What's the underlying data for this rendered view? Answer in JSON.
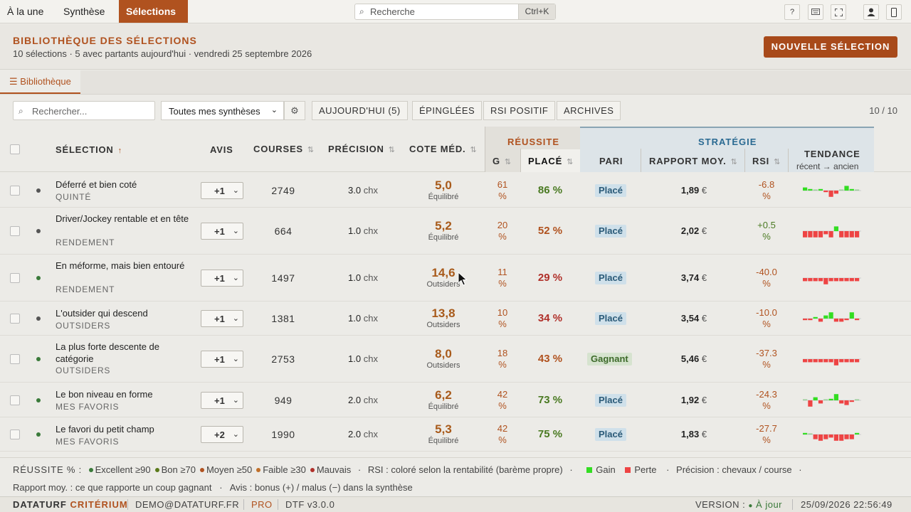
{
  "nav": {
    "tabs": [
      "À la une",
      "Synthèse",
      "Sélections"
    ],
    "active": 2
  },
  "search": {
    "placeholder": "Recherche",
    "shortcut": "Ctrl+K"
  },
  "toolbar": {
    "icons": [
      "help-icon",
      "keyboard-icon",
      "fullscreen-icon",
      "user-icon",
      "phone-icon"
    ],
    "help_label": "?"
  },
  "page": {
    "title": "BIBLIOTHÈQUE DES SÉLECTIONS",
    "subtitle": "10 sélections · 5 avec partants aujourd'hui · vendredi 25 septembre 2026",
    "new_button": "NOUVELLE SÉLECTION"
  },
  "tabs": {
    "library": "Bibliothèque"
  },
  "filters": {
    "search_placeholder": "Rechercher...",
    "select_value": "Toutes mes synthèses",
    "buttons": [
      "AUJOURD'HUI (5)",
      "ÉPINGLÉES",
      "RSI POSITIF",
      "ARCHIVES"
    ],
    "count": "10 / 10"
  },
  "columns": {
    "selection": "SÉLECTION",
    "avis": "AVIS",
    "courses": "COURSES",
    "precision": "PRÉCISION",
    "cote": "COTE MÉD.",
    "reussite": "RÉUSSITE",
    "g": "G",
    "place": "PLACÉ",
    "strategie": "STRATÉGIE",
    "pari": "PARI",
    "rapport": "RAPPORT MOY.",
    "rsi": "RSI",
    "tendance": "TENDANCE",
    "tendance_sub": "récent → ancien"
  },
  "rows": [
    {
      "name": "Déferré et bien coté",
      "category": "QUINTÉ",
      "dot": "#555555",
      "avis": "+1",
      "courses": "2749",
      "precision": "3.0",
      "unit": "chx",
      "cote": "5,0",
      "cote_label": "Équilibré",
      "g": "61",
      "pct": "%",
      "place": "86 %",
      "place_color": "#4a7a22",
      "pari": "Placé",
      "pari_type": "placed",
      "rapport": "1,89",
      "euro": "€",
      "rsi": "-6.8",
      "rsi_color": "#b0521f",
      "trend": [
        2,
        1,
        0,
        1,
        -1,
        -4,
        -2,
        0,
        3,
        1,
        0
      ]
    },
    {
      "name": "Driver/Jockey rentable et en tête",
      "category": "RENDEMENT",
      "dot": "#555555",
      "avis": "+1",
      "courses": "664",
      "precision": "1.0",
      "unit": "chx",
      "cote": "5,2",
      "cote_label": "Équilibré",
      "g": "20",
      "pct": "%",
      "place": "52 %",
      "place_color": "#b0521f",
      "pari": "Placé",
      "pari_type": "placed",
      "rapport": "2,02",
      "euro": "€",
      "rsi": "+0.5",
      "rsi_color": "#4a7a22",
      "trend": [
        -4,
        -4,
        -4,
        -4,
        -2,
        -4,
        3,
        -4,
        -4,
        -4,
        -4
      ]
    },
    {
      "name": "En méforme, mais bien entouré",
      "category": "RENDEMENT",
      "dot": "#3a7a3a",
      "avis": "+1",
      "courses": "1497",
      "precision": "1.0",
      "unit": "chx",
      "cote": "14,6",
      "cote_label": "Outsiders",
      "g": "11",
      "pct": "%",
      "place": "29 %",
      "place_color": "#b0302a",
      "pari": "Placé",
      "pari_type": "placed",
      "rapport": "3,74",
      "euro": "€",
      "rsi": "-40.0",
      "rsi_color": "#b0521f",
      "trend": [
        -2,
        -2,
        -2,
        -2,
        -4,
        -2,
        -2,
        -2,
        -2,
        -2,
        -2
      ]
    },
    {
      "name": "L'outsider qui descend",
      "category": "OUTSIDERS",
      "dot": "#555555",
      "avis": "+1",
      "courses": "1381",
      "precision": "1.0",
      "unit": "chx",
      "cote": "13,8",
      "cote_label": "Outsiders",
      "g": "10",
      "pct": "%",
      "place": "34 %",
      "place_color": "#b0302a",
      "pari": "Placé",
      "pari_type": "placed",
      "rapport": "3,54",
      "euro": "€",
      "rsi": "-10.0",
      "rsi_color": "#b0521f",
      "trend": [
        -1,
        -1,
        1,
        -2,
        2,
        4,
        -2,
        -2,
        -1,
        4,
        -1
      ]
    },
    {
      "name": "La plus forte descente de catégorie",
      "category": "OUTSIDERS",
      "dot": "#3a7a3a",
      "avis": "+1",
      "courses": "2753",
      "precision": "1.0",
      "unit": "chx",
      "cote": "8,0",
      "cote_label": "Outsiders",
      "g": "18",
      "pct": "%",
      "place": "43 %",
      "place_color": "#b0521f",
      "pari": "Gagnant",
      "pari_type": "win",
      "rapport": "5,46",
      "euro": "€",
      "rsi": "-37.3",
      "rsi_color": "#b0521f",
      "trend": [
        -2,
        -2,
        -2,
        -2,
        -2,
        -2,
        -4,
        -2,
        -2,
        -2,
        -2
      ]
    },
    {
      "name": "Le bon niveau en forme",
      "category": "MES FAVORIS",
      "dot": "#3a7a3a",
      "avis": "+1",
      "courses": "949",
      "precision": "2.0",
      "unit": "chx",
      "cote": "6,2",
      "cote_label": "Équilibré",
      "g": "42",
      "pct": "%",
      "place": "73 %",
      "place_color": "#4a7a22",
      "pari": "Placé",
      "pari_type": "placed",
      "rapport": "1,92",
      "euro": "€",
      "rsi": "-24.3",
      "rsi_color": "#b0521f",
      "trend": [
        0,
        -4,
        2,
        -2,
        0,
        1,
        4,
        -2,
        -3,
        -1,
        0
      ]
    },
    {
      "name": "Le favori du petit champ",
      "category": "MES FAVORIS",
      "dot": "#3a7a3a",
      "avis": "+2",
      "courses": "1990",
      "precision": "2.0",
      "unit": "chx",
      "cote": "5,3",
      "cote_label": "Équilibré",
      "g": "42",
      "pct": "%",
      "place": "75 %",
      "place_color": "#4a7a22",
      "pari": "Placé",
      "pari_type": "placed",
      "rapport": "1,83",
      "euro": "€",
      "rsi": "-27.7",
      "rsi_color": "#b0521f",
      "trend": [
        1,
        0,
        -3,
        -4,
        -3,
        -2,
        -4,
        -4,
        -3,
        -3,
        1
      ]
    }
  ],
  "legend": {
    "prefix": "RÉUSSITE % :",
    "items": [
      {
        "label": "Excellent ≥90",
        "color": "#3a7a3a"
      },
      {
        "label": "Bon ≥70",
        "color": "#5a7a1a"
      },
      {
        "label": "Moyen ≥50",
        "color": "#b0521f"
      },
      {
        "label": "Faible ≥30",
        "color": "#c0702a"
      },
      {
        "label": "Mauvais",
        "color": "#b0302a"
      }
    ],
    "rsi_text": "RSI : coloré selon la rentabilité (barème propre)",
    "gain": "Gain",
    "perte": "Perte",
    "precision_text": "Précision : chevaux / course",
    "line2": "Rapport moy. : ce que rapporte un coup gagnant   ·   Avis : bonus (+) / malus (−) dans la synthèse"
  },
  "footer": {
    "brand1": "DATATURF",
    "brand2": "CRITÉRIUM",
    "email": "DEMO@DATATURF.FR",
    "plan": "PRO",
    "version_short": "DTF v3.0.0",
    "version_label": "VERSION :",
    "version_status": "À jour",
    "datetime": "25/09/2026 22:56:49"
  },
  "colors": {
    "accent": "#b0521f",
    "gain": "#33dd22",
    "perte": "#ee4444"
  }
}
